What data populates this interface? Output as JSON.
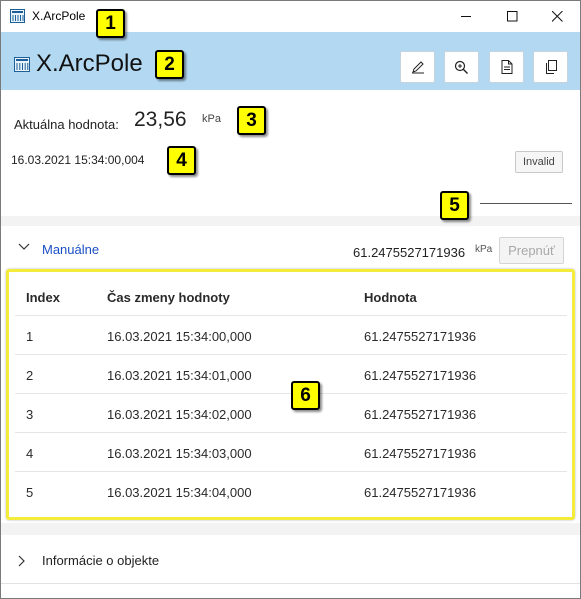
{
  "window": {
    "title": "X.ArcPole"
  },
  "header": {
    "title": "X.ArcPole",
    "buttons": [
      {
        "name": "edit-button",
        "icon": "pencil-icon"
      },
      {
        "name": "zoom-button",
        "icon": "zoom-in-icon"
      },
      {
        "name": "document-button",
        "icon": "document-icon"
      },
      {
        "name": "copy-button",
        "icon": "copy-icon"
      }
    ]
  },
  "value": {
    "label": "Aktuálna hodnota:",
    "number": "23,56",
    "unit": "kPa",
    "timestamp": "16.03.2021 15:34:00,004",
    "status": "Invalid",
    "dash": "_______________"
  },
  "manual": {
    "label": "Manuálne",
    "value": "61.2475527171936",
    "unit": "kPa",
    "switch_label": "Prepnúť"
  },
  "table": {
    "headers": [
      "Index",
      "Čas zmeny hodnoty",
      "Hodnota"
    ],
    "rows": [
      [
        "1",
        "16.03.2021 15:34:00,000",
        "61.2475527171936"
      ],
      [
        "2",
        "16.03.2021 15:34:01,000",
        "61.2475527171936"
      ],
      [
        "3",
        "16.03.2021 15:34:02,000",
        "61.2475527171936"
      ],
      [
        "4",
        "16.03.2021 15:34:03,000",
        "61.2475527171936"
      ],
      [
        "5",
        "16.03.2021 15:34:04,000",
        "61.2475527171936"
      ]
    ]
  },
  "info": {
    "label": "Informácie o objekte"
  },
  "markers": [
    "1",
    "2",
    "3",
    "4",
    "5",
    "6"
  ],
  "colors": {
    "header_bg": "#b3d9f2",
    "link": "#1a4fc4",
    "marker": "#ffff00",
    "highlight": "#f4ec3a"
  }
}
